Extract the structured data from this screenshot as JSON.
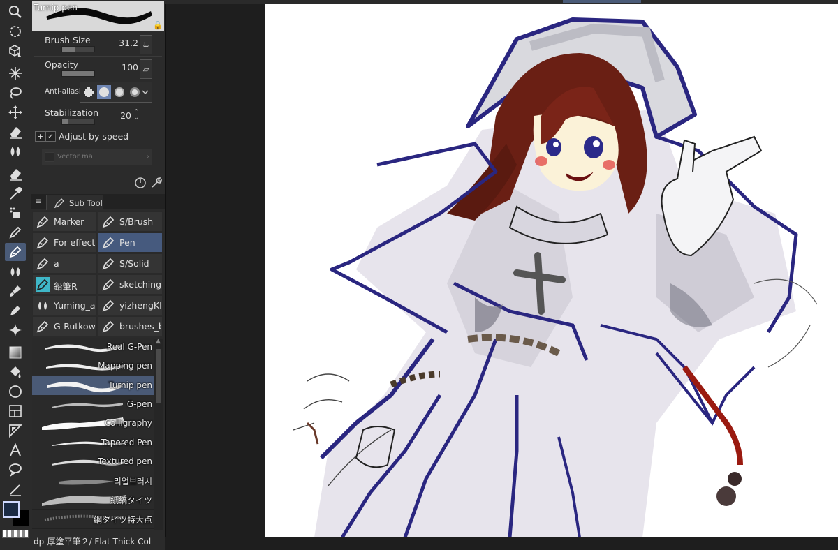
{
  "tool_property": {
    "brush_name": "Turnip pen",
    "brush_size_label": "Brush Size",
    "brush_size_value": "31.2",
    "opacity_label": "Opacity",
    "opacity_value": "100",
    "anti_aliasing_label": "Anti-aliasin",
    "stabilization_label": "Stabilization",
    "stabilization_value": "20",
    "adjust_by_speed_label": "Adjust by speed",
    "adjust_by_speed_checked": true,
    "vector_magnet_label": "Vector ma"
  },
  "sub_tool": {
    "tab_label": "Sub Tool",
    "groups": [
      {
        "label": "Marker",
        "selected": false
      },
      {
        "label": "S/Brush",
        "selected": false
      },
      {
        "label": "For effect li",
        "selected": false
      },
      {
        "label": "Pen",
        "selected": true
      },
      {
        "label": "a",
        "selected": false
      },
      {
        "label": "S/Solid",
        "selected": false
      },
      {
        "label": "鉛筆R",
        "selected": false
      },
      {
        "label": "sketching",
        "selected": false
      },
      {
        "label": "Yuming_ab",
        "selected": false
      },
      {
        "label": "yizhengKE",
        "selected": false
      },
      {
        "label": "G-Rutkows",
        "selected": false
      },
      {
        "label": "brushes_by",
        "selected": false
      }
    ],
    "brushes": [
      {
        "name": "Real G-Pen",
        "selected": false
      },
      {
        "name": "Mapping pen",
        "selected": false
      },
      {
        "name": "Turnip pen",
        "selected": true
      },
      {
        "name": "G-pen",
        "selected": false
      },
      {
        "name": "Calligraphy",
        "selected": false
      },
      {
        "name": "Tapered Pen",
        "selected": false
      },
      {
        "name": "Textured pen",
        "selected": false
      },
      {
        "name": "리얼브러시",
        "selected": false
      },
      {
        "name": "紙縞タイツ",
        "selected": false
      },
      {
        "name": "網タイツ特大点",
        "selected": false
      }
    ],
    "bottom_brush_name": "dp-厚塗平筆２/ Flat Thick Col"
  },
  "colors": {
    "accent": "#4a5b78",
    "panel_bg": "#2b2b2b",
    "canvas_bg": "#ffffff",
    "main_color": "#1a2a44",
    "sub_color": "#000000"
  },
  "toolbar_icons": [
    "zoom-icon",
    "select-lasso-icon",
    "3d-object-icon",
    "magic-wand-icon",
    "lasso-icon",
    "move-icon",
    "eraser-icon",
    "blend-icon",
    "eraser-2-icon",
    "eyedropper-icon",
    "fill-bucket-icon",
    "pencil-icon",
    "pen-icon",
    "drops-icon",
    "brush-icon",
    "decoration-icon",
    "sparkle-icon",
    "gradient-icon",
    "fill-icon",
    "figure-icon",
    "frame-icon",
    "ruler-icon",
    "text-icon",
    "balloon-icon",
    "line-correction-icon"
  ]
}
